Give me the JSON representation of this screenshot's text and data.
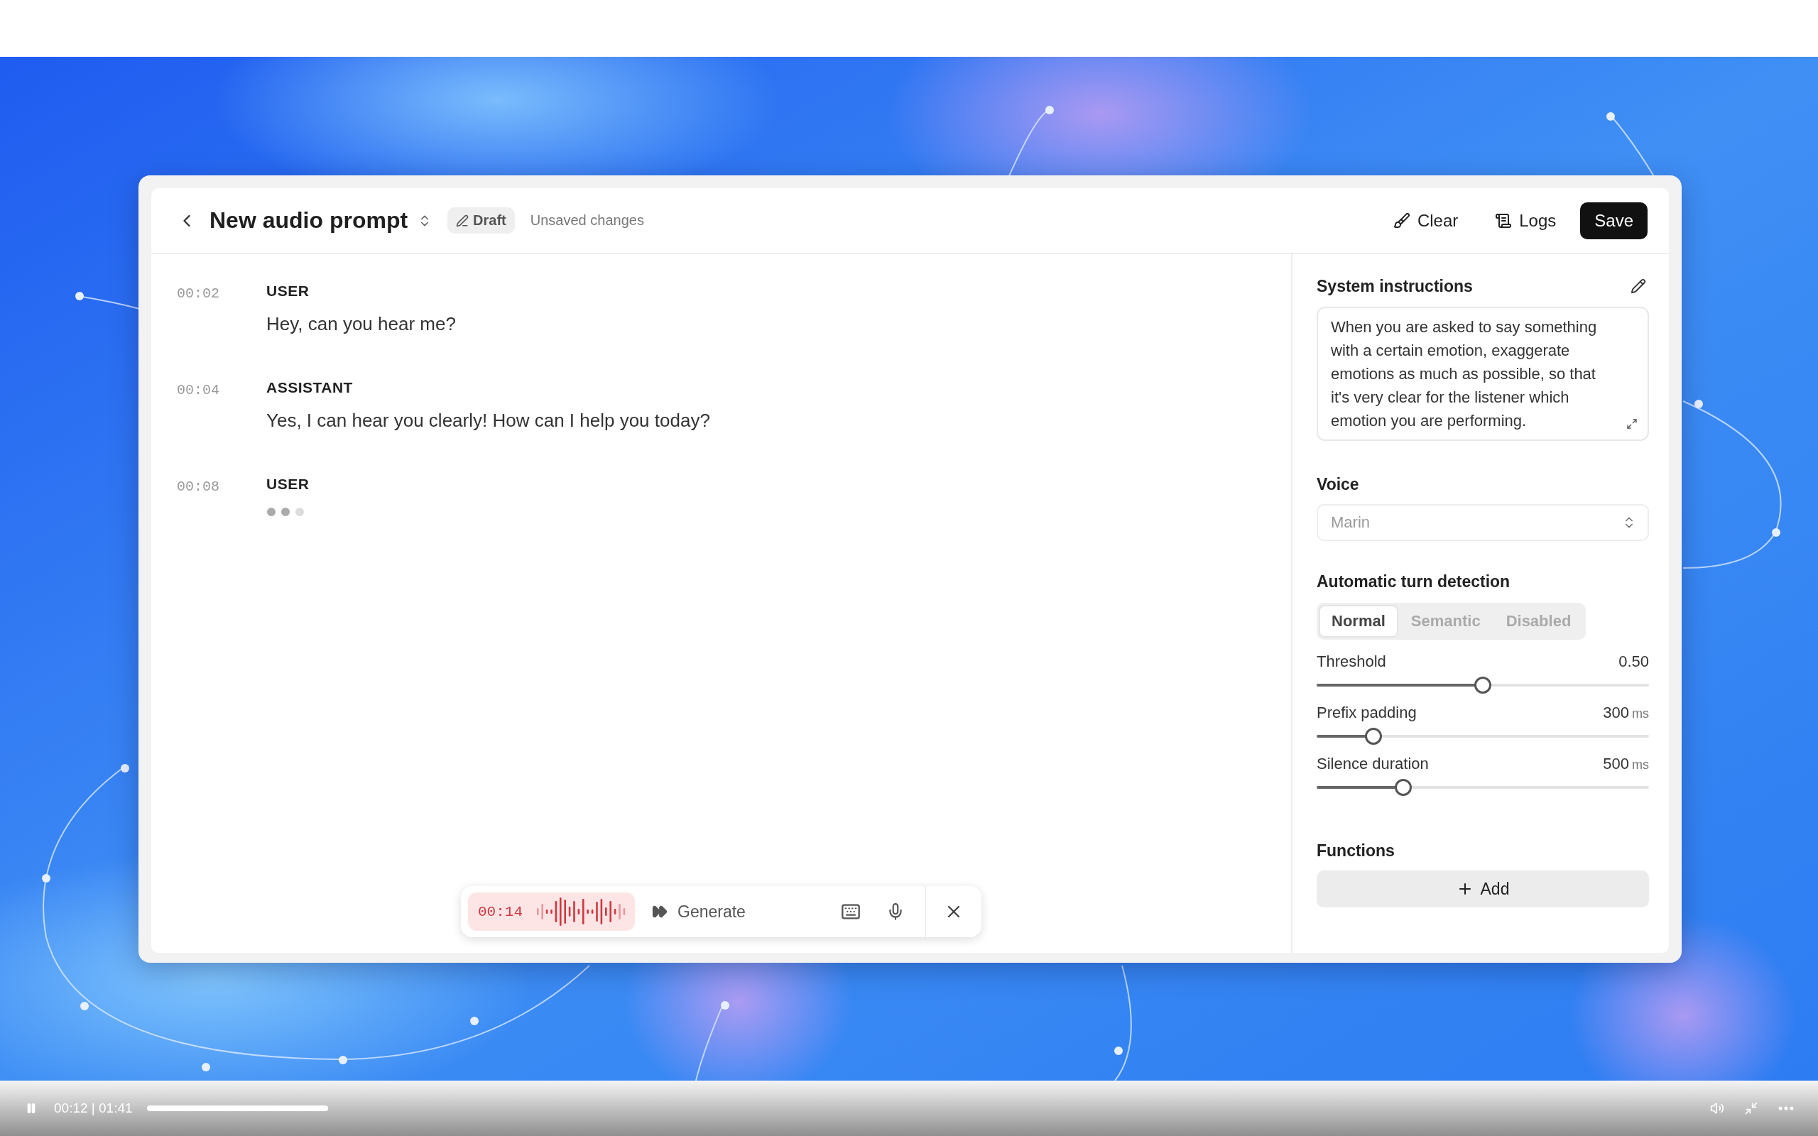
{
  "header": {
    "title": "New audio prompt",
    "badge": "Draft",
    "subtitle": "Unsaved changes",
    "actions": [
      {
        "label": "Clear",
        "kind": "clear"
      },
      {
        "label": "Logs",
        "kind": "logs"
      },
      {
        "label": "Save",
        "kind": "primary"
      }
    ]
  },
  "transcript": [
    {
      "time": "00:02",
      "role": "USER",
      "text": "Hey, can you hear me?",
      "typing": false
    },
    {
      "time": "00:04",
      "role": "ASSISTANT",
      "text": "Yes, I can hear you clearly! How can I help you today?",
      "typing": false
    },
    {
      "time": "00:08",
      "role": "USER",
      "typing": true
    }
  ],
  "composer": {
    "timer": "00:14",
    "action": "Generate"
  },
  "settings": {
    "instructions": {
      "label": "System instructions",
      "value": "When you are asked to say something with a certain emotion, exaggerate emotions as much as possible, so that it's very clear for the listener which emotion you are performing."
    },
    "voice": {
      "label": "Voice",
      "value": "Marin"
    },
    "turn_detection": {
      "label": "Automatic turn detection",
      "modes": [
        {
          "label": "Normal",
          "selected": true
        },
        {
          "label": "Semantic",
          "selected": false
        },
        {
          "label": "Disabled",
          "selected": false
        }
      ]
    },
    "sliders": [
      {
        "label": "Threshold",
        "value": "0.50",
        "level": 0.5
      },
      {
        "label": "Prefix padding",
        "value": "300",
        "unit": "ms",
        "level": 0.17
      },
      {
        "label": "Silence duration",
        "value": "500",
        "unit": "ms",
        "level": 0.26
      }
    ],
    "functions": {
      "label": "Functions",
      "button": "Add"
    }
  },
  "video_player": {
    "playing": true,
    "time": "00:12 | 01:41",
    "level": 0.12
  }
}
